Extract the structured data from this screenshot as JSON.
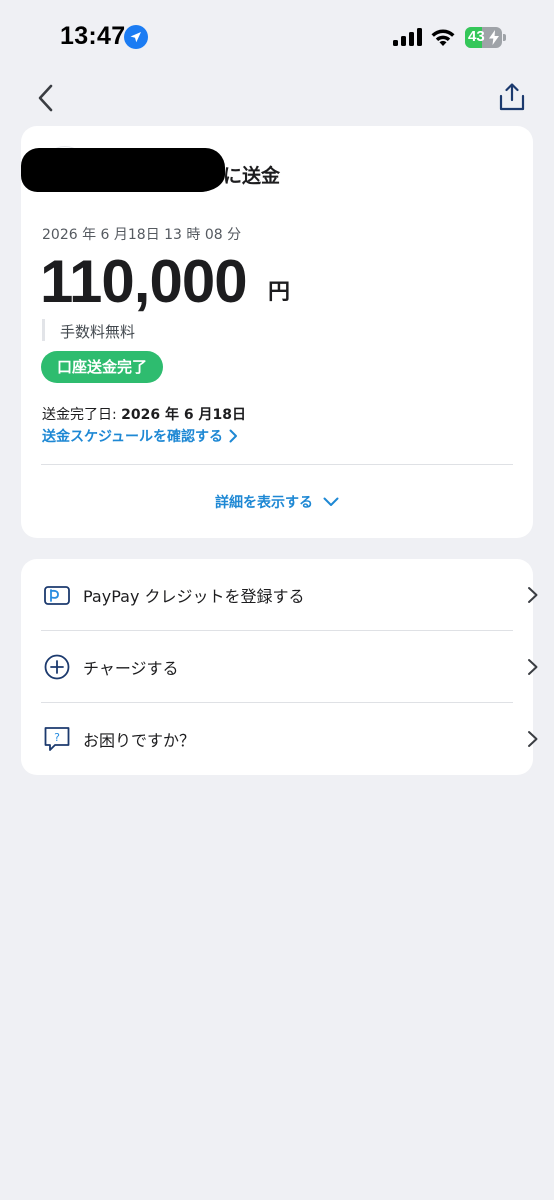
{
  "status_bar": {
    "time": "13:47",
    "battery": "43"
  },
  "transfer": {
    "recipient_suffix": "に送金",
    "datetime": "2026 年 6 月18日 13 時 08 分",
    "amount": "110,000",
    "currency": "円",
    "fee": "手数料無料",
    "status": "口座送金完了",
    "completion_label": "送金完了日:",
    "completion_date": "2026 年 6 月18日",
    "schedule_link": "送金スケジュールを確認する",
    "details_toggle": "詳細を表示する"
  },
  "menu": {
    "items": [
      {
        "label": "PayPay クレジットを登録する",
        "icon": "paypay-card-icon"
      },
      {
        "label": "チャージする",
        "icon": "plus-circle-icon"
      },
      {
        "label": "お困りですか？",
        "icon": "help-chat-icon"
      }
    ]
  },
  "colors": {
    "background": "#eff0f4",
    "card": "#ffffff",
    "accent_blue": "#1e88d4",
    "success_green": "#2ebc6f",
    "icon_navy": "#1c3a6e"
  }
}
